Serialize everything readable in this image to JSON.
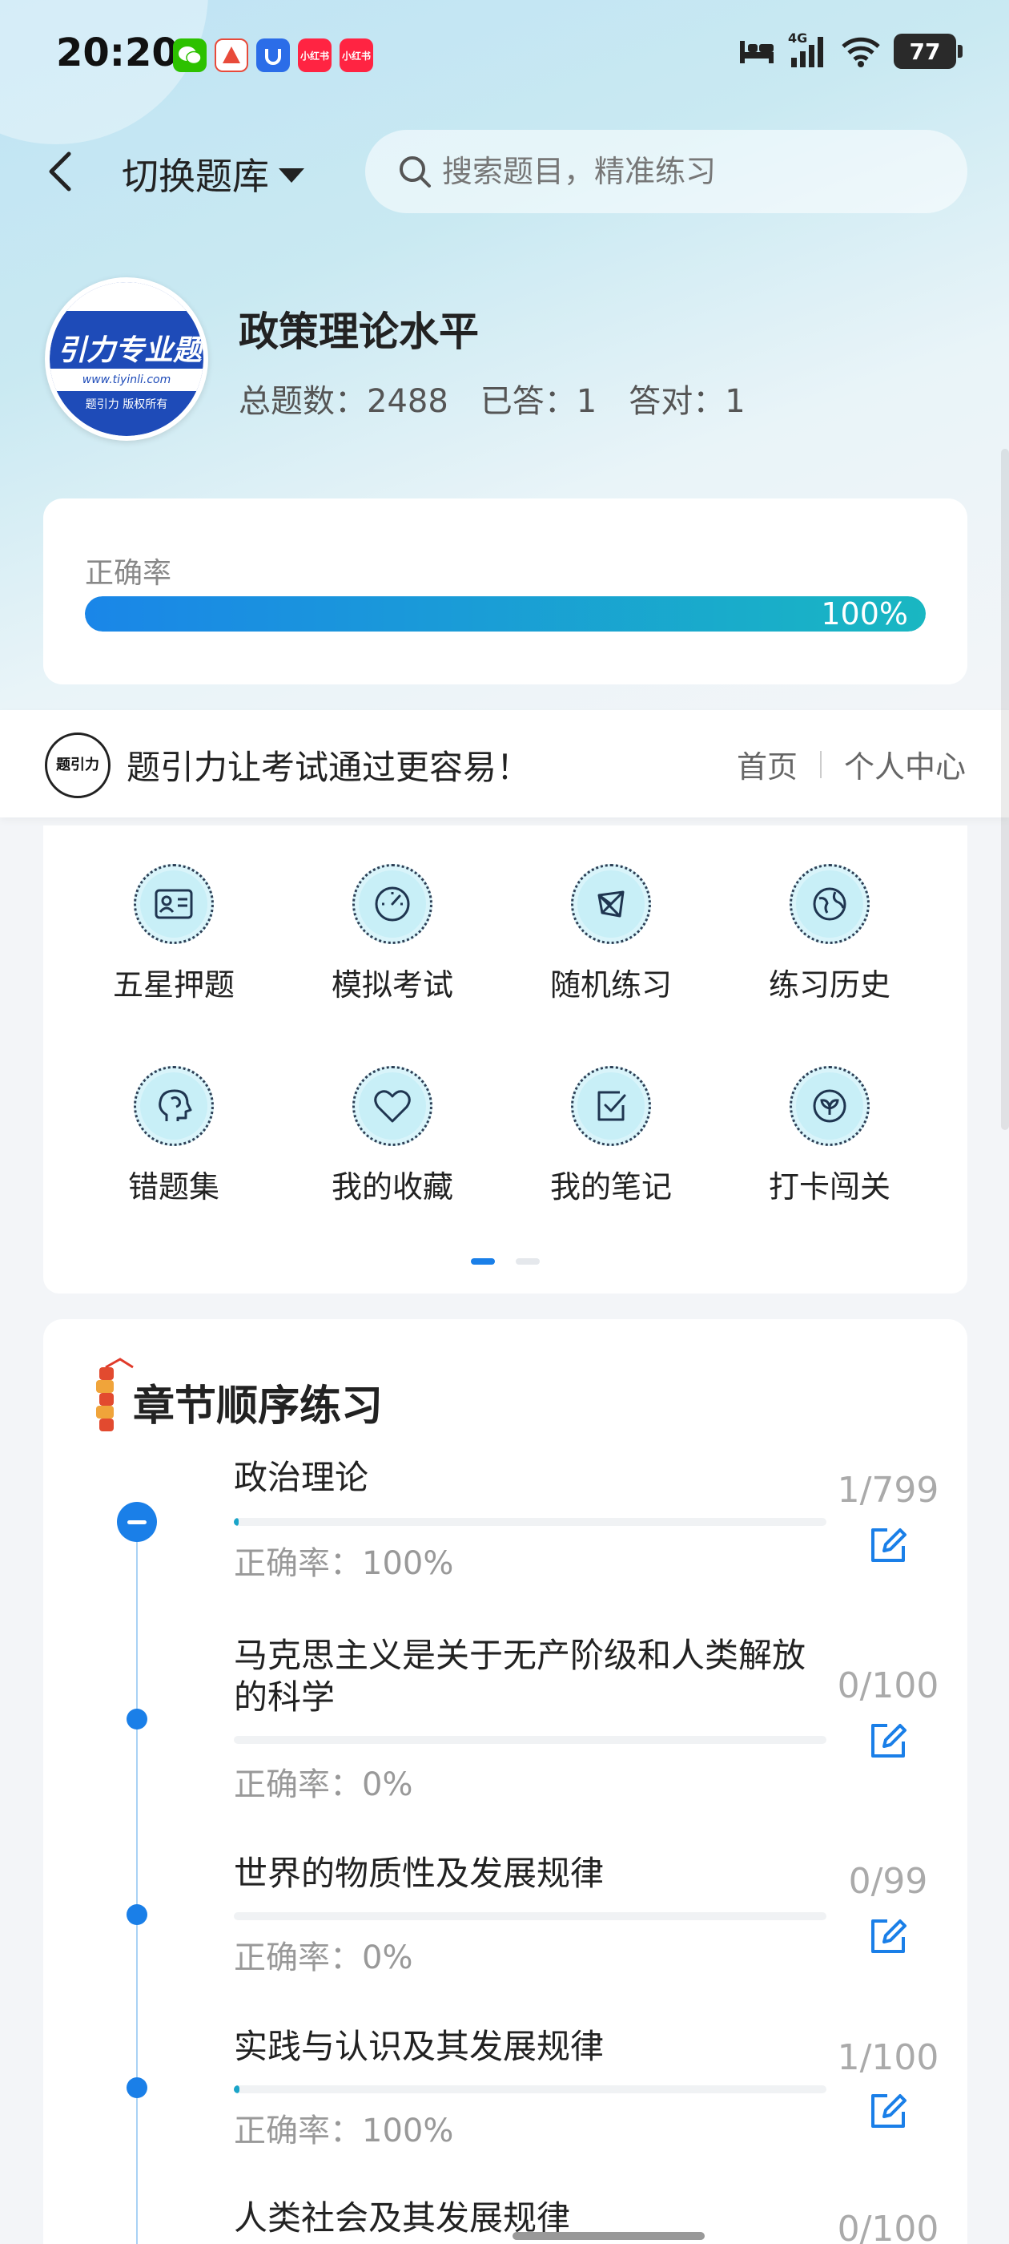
{
  "status_bar": {
    "time": "20:20",
    "network": "4G",
    "battery": "77",
    "apps": [
      {
        "name": "wechat-icon",
        "color": "#2dc100",
        "label": ""
      },
      {
        "name": "app-red-icon",
        "color": "#e84a3a",
        "label": ""
      },
      {
        "name": "app-blue-icon",
        "color": "#2b6de8",
        "label": ""
      },
      {
        "name": "xiaohongshu-icon",
        "color": "#ff2442",
        "label": "小红书"
      },
      {
        "name": "xiaohongshu-icon-2",
        "color": "#ff2442",
        "label": "小红书"
      }
    ]
  },
  "header": {
    "switch_label": "切换题库",
    "search_placeholder": "搜索题目，精准练习"
  },
  "bank": {
    "logo_text": "引力专业题",
    "logo_url": "www.tiyinli.com",
    "logo_sub": "题引力 版权所有",
    "title": "政策理论水平",
    "total": "总题数：2488",
    "answered": "已答：1",
    "correct": "答对：1"
  },
  "accuracy": {
    "label": "正确率",
    "percent_text": "100%",
    "value": 1.0
  },
  "banner": {
    "logo_text": "题引力",
    "slogan": "题引力让考试通过更容易！",
    "home": "首页",
    "profile": "个人中心"
  },
  "features": [
    {
      "label": "五星押题",
      "icon": "id-card-icon"
    },
    {
      "label": "模拟考试",
      "icon": "speedometer-icon"
    },
    {
      "label": "随机练习",
      "icon": "network-icon"
    },
    {
      "label": "练习历史",
      "icon": "globe-icon"
    },
    {
      "label": "错题集",
      "icon": "brain-icon"
    },
    {
      "label": "我的收藏",
      "icon": "heart-icon"
    },
    {
      "label": "我的笔记",
      "icon": "check-note-icon"
    },
    {
      "label": "打卡闯关",
      "icon": "badge-icon"
    }
  ],
  "chapters": {
    "title": "章节顺序练习",
    "items": [
      {
        "name": "政治理论",
        "accuracy": "正确率：100%",
        "count": "1/799",
        "progress": 0.0013
      },
      {
        "name": "马克思主义是关于无产阶级和人类解放的科学",
        "accuracy": "正确率：0%",
        "count": "0/100",
        "progress": 0
      },
      {
        "name": "世界的物质性及发展规律",
        "accuracy": "正确率：0%",
        "count": "0/99",
        "progress": 0
      },
      {
        "name": "实践与认识及其发展规律",
        "accuracy": "正确率：100%",
        "count": "1/100",
        "progress": 0.01
      },
      {
        "name": "人类社会及其发展规律",
        "accuracy": "",
        "count": "0/100",
        "progress": 0
      }
    ]
  }
}
